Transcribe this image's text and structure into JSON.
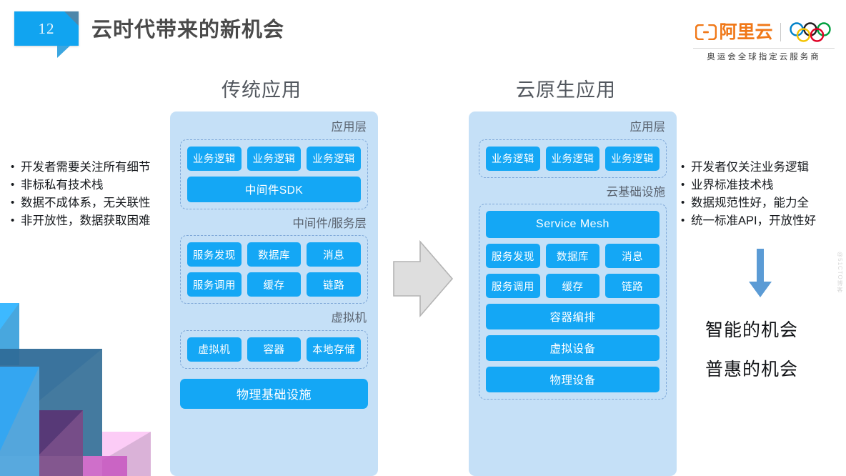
{
  "slide": {
    "number": "12",
    "title": "云时代带来的新机会"
  },
  "brand": {
    "logo_icon": "alibaba-cloud-logo-icon",
    "name_cn": "阿里云",
    "rings_icon": "olympic-rings-icon",
    "tagline": "奥运会全球指定云服务商"
  },
  "columns": {
    "left_heading": "传统应用",
    "right_heading": "云原生应用"
  },
  "traditional": {
    "app_layer": {
      "label": "应用层",
      "chips": [
        "业务逻辑",
        "业务逻辑",
        "业务逻辑"
      ],
      "sdk_bar": "中间件SDK"
    },
    "middleware_layer": {
      "label": "中间件/服务层",
      "row1": [
        "服务发现",
        "数据库",
        "消息"
      ],
      "row2": [
        "服务调用",
        "缓存",
        "链路"
      ]
    },
    "vm_layer": {
      "label": "虚拟机",
      "chips": [
        "虚拟机",
        "容器",
        "本地存储"
      ]
    },
    "physical_bar": "物理基础设施"
  },
  "cloudnative": {
    "app_layer": {
      "label": "应用层",
      "chips": [
        "业务逻辑",
        "业务逻辑",
        "业务逻辑"
      ]
    },
    "infra_layer": {
      "label": "云基础设施",
      "mesh_bar": "Service Mesh",
      "row1": [
        "服务发现",
        "数据库",
        "消息"
      ],
      "row2": [
        "服务调用",
        "缓存",
        "链路"
      ],
      "bars": [
        "容器编排",
        "虚拟设备",
        "物理设备"
      ]
    }
  },
  "bullets_left": [
    "开发者需要关注所有细节",
    "非标私有技术栈",
    "数据不成体系，无关联性",
    "非开放性，数据获取困难"
  ],
  "bullets_right": [
    "开发者仅关注业务逻辑",
    "业界标准技术栈",
    "数据规范性好，能力全",
    "统一标准API，开放性好"
  ],
  "transition_arrow_icon": "right-arrow-icon",
  "down_arrow_icon": "down-arrow-icon",
  "outcomes": [
    "智能的机会",
    "普惠的机会"
  ],
  "watermark": "@51CTO博客",
  "colors": {
    "accent_blue": "#14a7f5",
    "panel_bg": "#c5e0f7",
    "dash_border": "#7fa8d8",
    "brand_orange": "#f07818",
    "title_gray": "#4a4a4a",
    "down_arrow": "#5b9bd5",
    "transition_arrow": "#dcdcdc"
  }
}
